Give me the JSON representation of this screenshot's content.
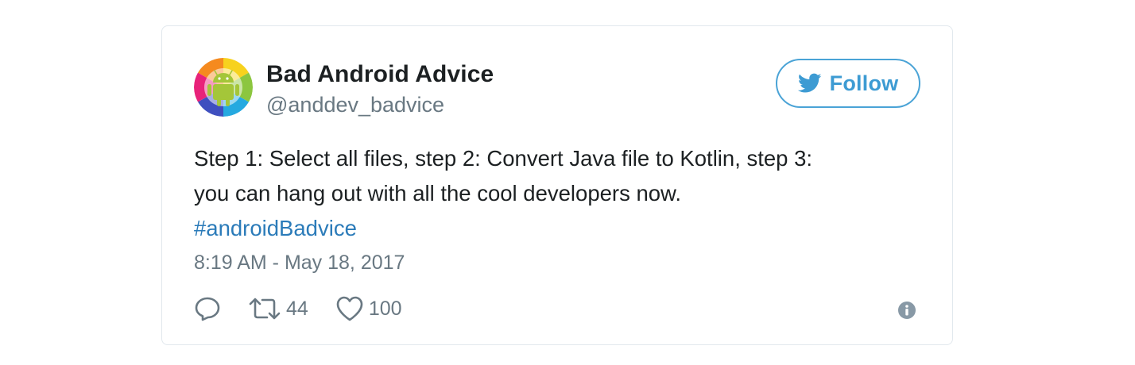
{
  "tweet": {
    "author": {
      "name": "Bad Android Advice",
      "handle": "@anddev_badvice"
    },
    "follow_label": "Follow",
    "text_lines": [
      "Step 1: Select all files, step 2: Convert Java file to Kotlin, step 3:",
      "you can hang out with all the cool developers now."
    ],
    "hashtag": "#androidBadvice",
    "timestamp": "8:19 AM - May 18, 2017",
    "retweet_count": "44",
    "like_count": "100"
  },
  "icons": {
    "avatar": "android-robot-on-rainbow-wheel",
    "follow": "twitter-bird-icon",
    "reply": "reply-icon",
    "retweet": "retweet-icon",
    "like": "heart-icon",
    "info": "info-icon"
  },
  "colors": {
    "link": "#2b7bb9",
    "follow_accent": "#3d9bd3",
    "muted_text": "#697882",
    "card_border": "#e1e8ed",
    "text": "#1c2022"
  }
}
